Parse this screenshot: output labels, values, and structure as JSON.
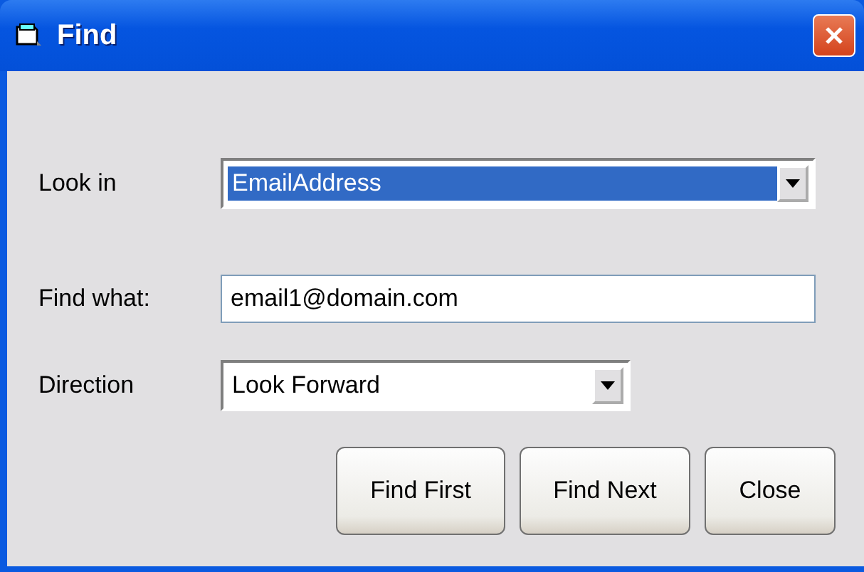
{
  "window": {
    "title": "Find"
  },
  "fields": [
    {
      "kind": "dropdown",
      "label": "Look in",
      "value": "EmailAddress",
      "selected": true,
      "wide": true
    },
    {
      "kind": "text",
      "label": "Find what:",
      "value": "email1@domain.com",
      "selected": false,
      "wide": true
    },
    {
      "kind": "dropdown",
      "label": "Direction",
      "value": "Look Forward",
      "selected": false,
      "wide": false
    }
  ],
  "buttons": [
    "Find First",
    "Find Next",
    "Close"
  ]
}
